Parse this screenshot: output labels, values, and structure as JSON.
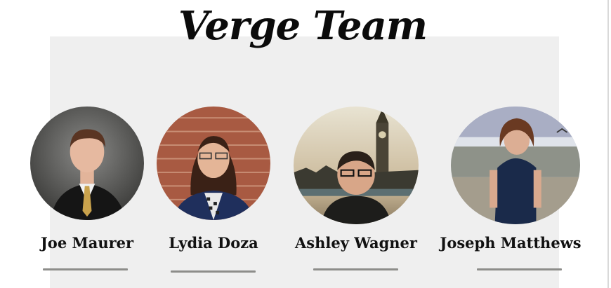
{
  "page": {
    "title": "Verge Team",
    "panel_color": "#efefef"
  },
  "team": [
    {
      "name": "Joe Maurer",
      "photo": "portrait-photo-suit-gray-backdrop"
    },
    {
      "name": "Lydia Doza",
      "photo": "portrait-photo-brick-wall"
    },
    {
      "name": "Ashley Wagner",
      "photo": "portrait-photo-big-ben"
    },
    {
      "name": "Joseph Matthews",
      "photo": "portrait-photo-beach"
    }
  ]
}
